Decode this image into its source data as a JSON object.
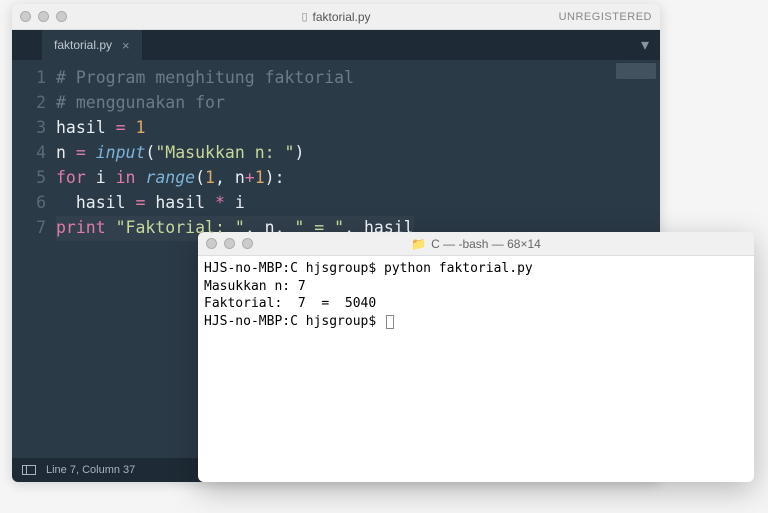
{
  "editor": {
    "title": "faktorial.py",
    "registration": "UNREGISTERED",
    "tab": {
      "label": "faktorial.py",
      "close": "×"
    },
    "gutter": [
      "1",
      "2",
      "3",
      "4",
      "5",
      "6",
      "7"
    ],
    "code": {
      "l1": "# Program menghitung faktorial",
      "l2": "# menggunakan for",
      "l3a": "hasil ",
      "l3b": "=",
      "l3c": " ",
      "l3d": "1",
      "l4a": "n ",
      "l4b": "=",
      "l4c": " ",
      "l4d": "input",
      "l4e": "(",
      "l4f": "\"Masukkan n: \"",
      "l4g": ")",
      "l5a": "for",
      "l5b": " i ",
      "l5c": "in",
      "l5d": " ",
      "l5e": "range",
      "l5f": "(",
      "l5g": "1",
      "l5h": ", n",
      "l5i": "+",
      "l5j": "1",
      "l5k": "):",
      "l6a": "  hasil ",
      "l6b": "=",
      "l6c": " hasil ",
      "l6d": "*",
      "l6e": " i",
      "l7a": "print",
      "l7b": " ",
      "l7c": "\"Faktorial: \"",
      "l7d": ", n, ",
      "l7e": "\" = \"",
      "l7f": ", hasil"
    },
    "status": "Line 7, Column 37"
  },
  "terminal": {
    "title": "C — -bash — 68×14",
    "lines": [
      "HJS-no-MBP:C hjsgroup$ python faktorial.py",
      "Masukkan n: 7",
      "Faktorial:  7  =  5040",
      "HJS-no-MBP:C hjsgroup$ "
    ]
  }
}
